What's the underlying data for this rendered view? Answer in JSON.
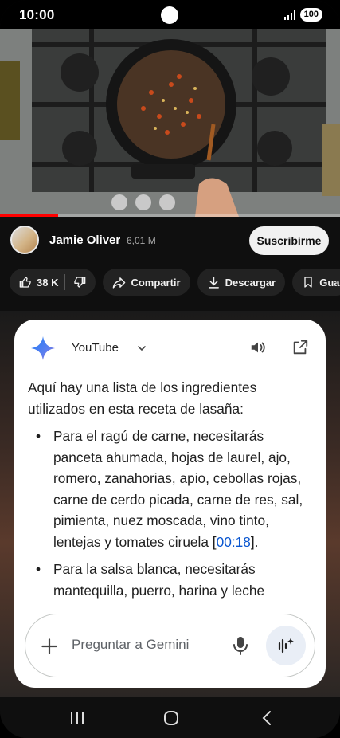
{
  "status_bar": {
    "time": "10:00",
    "battery": "100"
  },
  "video": {
    "progress": 0.17
  },
  "channel": {
    "name": "Jamie Oliver",
    "subscribers": "6,01 M",
    "subscribe_label": "Suscribirme"
  },
  "actions": {
    "likes": "38 K",
    "share_label": "Compartir",
    "download_label": "Descargar",
    "save_label": "Gua"
  },
  "gemini": {
    "source": "YouTube",
    "intro": "Aquí hay una lista de los ingredientes utilizados en esta receta de lasaña:",
    "bullets": [
      {
        "text": "Para el ragú de carne, necesitarás panceta ahumada, hojas de laurel, ajo, romero, zanahorias, apio, cebollas rojas, carne de cerdo picada, carne de res, sal, pimienta, nuez moscada, vino tinto, lentejas y tomates ciruela [",
        "timestamp": "00:18",
        "suffix": "]."
      },
      {
        "text": "Para la salsa blanca, necesitarás mantequilla, puerro, harina y leche"
      }
    ],
    "input_placeholder": "Preguntar a Gemini"
  }
}
